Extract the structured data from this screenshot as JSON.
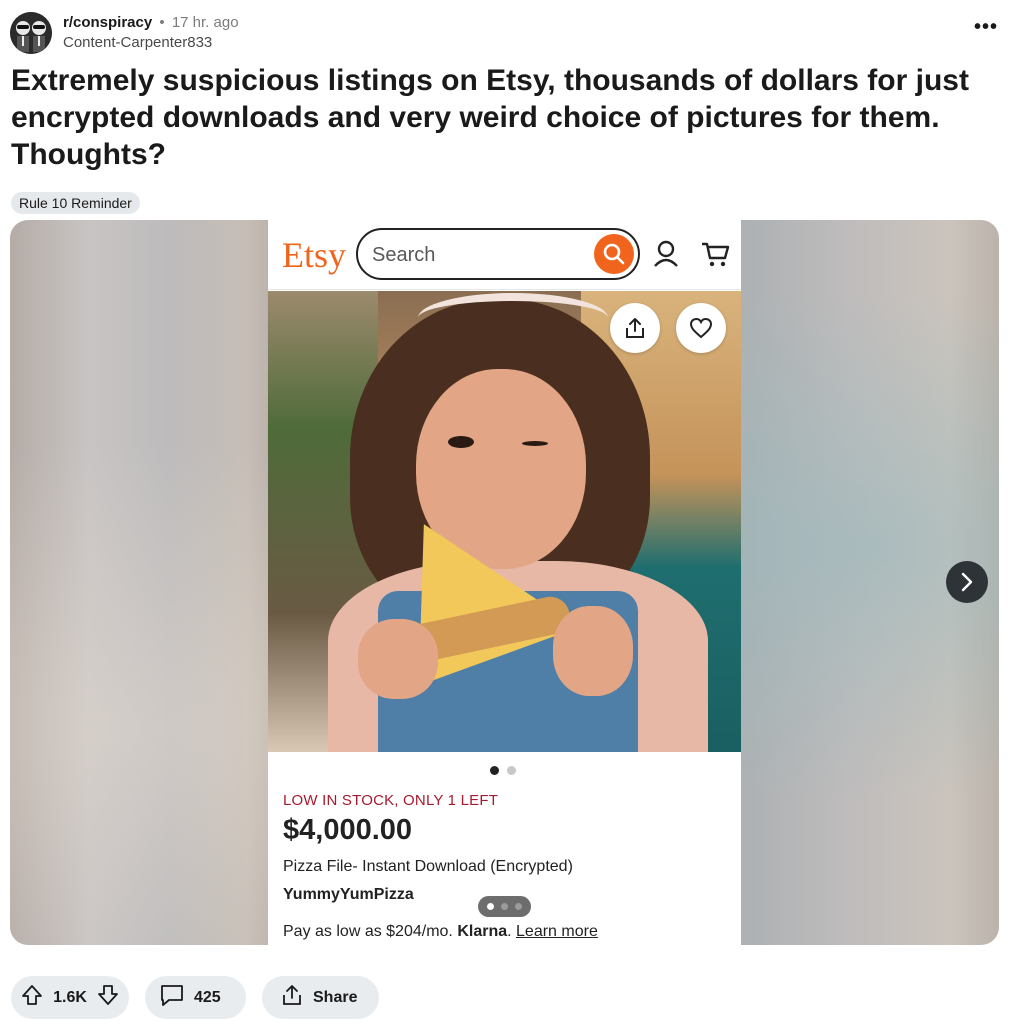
{
  "post": {
    "subreddit": "r/conspiracy",
    "separator": "•",
    "time": "17 hr. ago",
    "author": "Content-Carpenter833",
    "more_label": "•••",
    "title": "Extremely suspicious listings on Etsy, thousands of dollars for just encrypted downloads and very weird choice of pictures for them. Thoughts?",
    "flair": "Rule 10 Reminder"
  },
  "etsy": {
    "logo": "Etsy",
    "search_placeholder": "Search",
    "stock_notice": "LOW IN STOCK, ONLY 1 LEFT",
    "price": "$4,000.00",
    "item_title": "Pizza File- Instant Download (Encrypted)",
    "shop_name": "YummyYumPizza",
    "pay_text": "Pay as low as $204/mo.",
    "klarna": "Klarna",
    "pay_period": ".",
    "learn_more": "Learn more",
    "accent_color": "#f1641e"
  },
  "actions": {
    "vote_count": "1.6K",
    "comment_count": "425",
    "share_label": "Share"
  },
  "icons": [
    "upvote-icon",
    "downvote-icon",
    "comment-icon",
    "share-icon",
    "search-icon",
    "user-icon",
    "cart-icon",
    "heart-icon",
    "chevron-right-icon"
  ]
}
